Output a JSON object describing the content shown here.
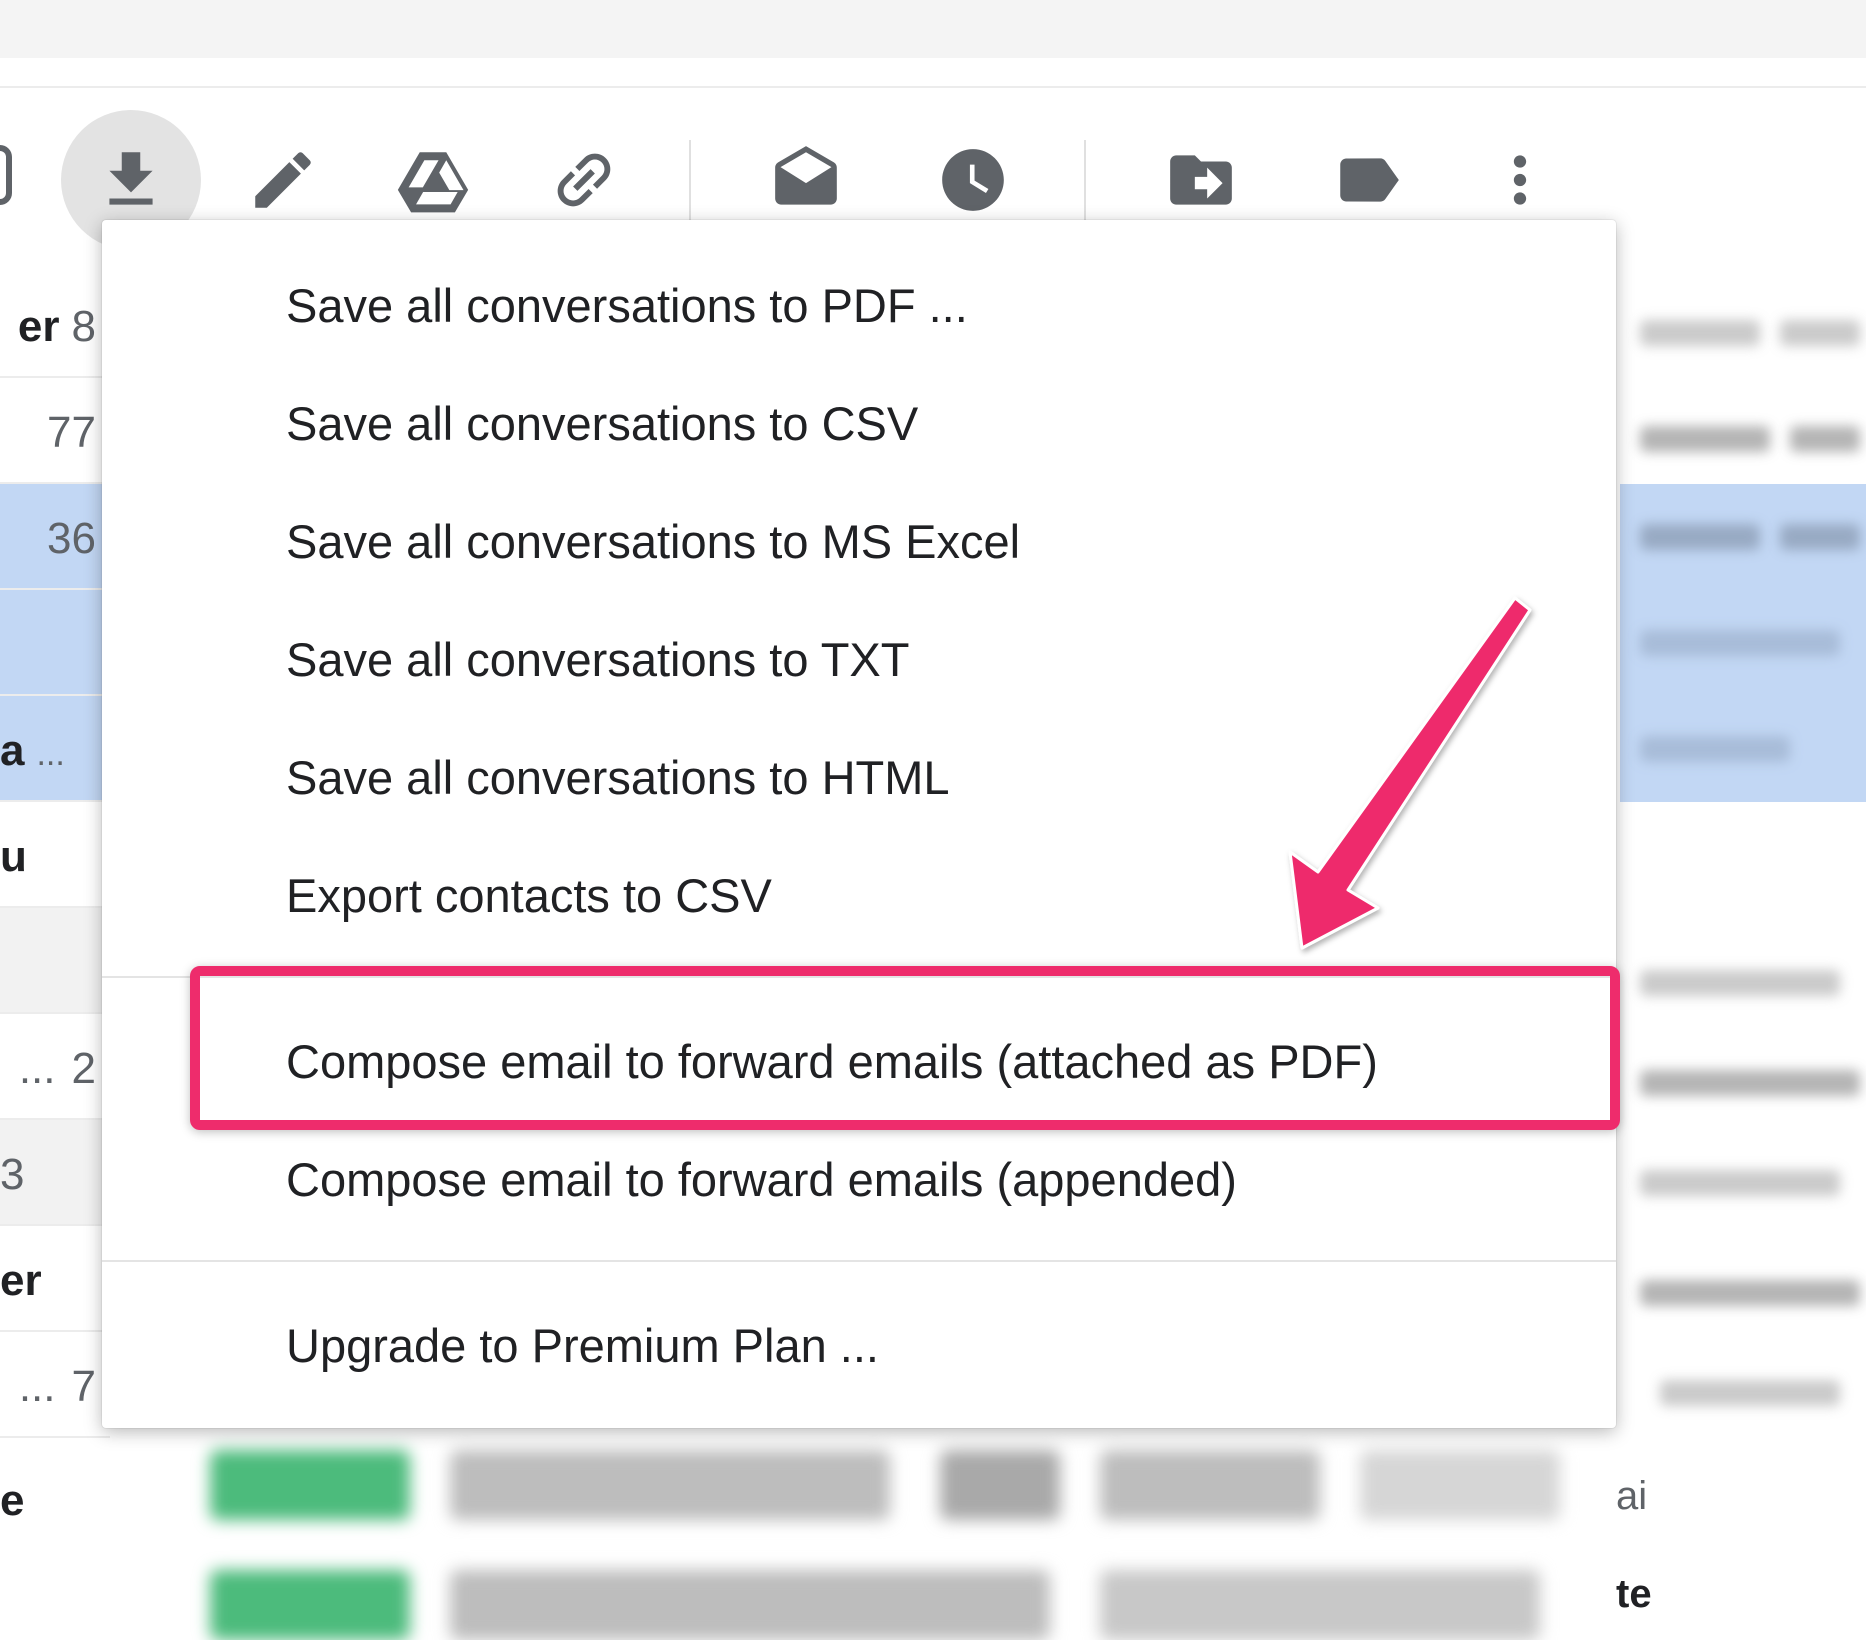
{
  "toolbar": {
    "buttons": [
      {
        "icon": "download-icon",
        "active": true
      },
      {
        "icon": "pencil-icon"
      },
      {
        "icon": "google-drive-icon"
      },
      {
        "icon": "link-icon"
      },
      {
        "icon": "mark-as-read-icon"
      },
      {
        "icon": "snooze-clock-icon"
      },
      {
        "icon": "move-to-icon"
      },
      {
        "icon": "label-icon"
      },
      {
        "icon": "more-vert-icon"
      }
    ]
  },
  "email_list": {
    "rows": [
      {
        "sender_fragment": "er",
        "count": "8"
      },
      {
        "count": "77"
      },
      {
        "count": "36"
      },
      {
        "count": ""
      },
      {
        "sender_fragment": "a",
        "count": "..."
      },
      {
        "sender_fragment": "u",
        "count": ""
      },
      {
        "count": ""
      },
      {
        "sender_fragment": "...",
        "count": "2"
      },
      {
        "sender_fragment": "3",
        "count": ""
      },
      {
        "sender_fragment": "er",
        "count": ""
      },
      {
        "sender_fragment": "...",
        "count": "7"
      }
    ],
    "bottom_fragment": "e",
    "right_fragments": [
      "ai",
      "te"
    ]
  },
  "menu": {
    "items": [
      "Save all conversations to PDF ...",
      "Save all conversations to CSV",
      "Save all conversations to MS Excel",
      "Save all conversations to TXT",
      "Save all conversations to HTML",
      "Export contacts to CSV",
      "Compose email to forward emails (attached as PDF)",
      "Compose email to forward emails (appended)",
      "Upgrade to Premium Plan ..."
    ]
  },
  "annotation": {
    "highlight_color": "#ee2c6c",
    "highlighted_item": "Compose email to forward emails (attached as PDF)"
  },
  "colors": {
    "selected_row": "#c2d7f4",
    "icon": "#5f6368",
    "label_green": "#4cbb7c"
  }
}
